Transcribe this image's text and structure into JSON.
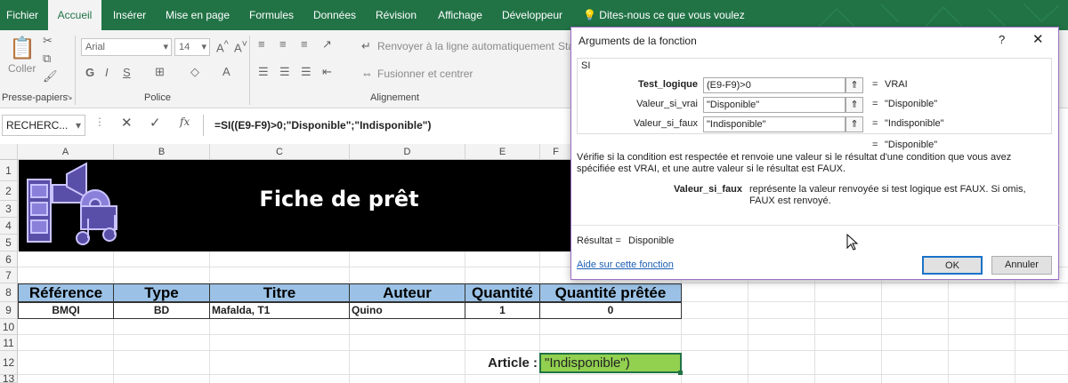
{
  "tabs": [
    "Fichier",
    "Accueil",
    "Insérer",
    "Mise en page",
    "Formules",
    "Données",
    "Révision",
    "Affichage",
    "Développeur"
  ],
  "tell_me": "Dites-nous ce que vous voulez faire",
  "ribbon": {
    "paste_label": "Coller",
    "clipboard_group": "Presse-papiers",
    "font_name": "Arial",
    "font_size": "14",
    "font_group": "Police",
    "wrap_text": "Renvoyer à la ligne automatiquement",
    "merge_center": "Fusionner et centrer",
    "alignment_group": "Alignement",
    "style_partial": "Sta"
  },
  "formula_bar": {
    "name_box": "RECHERC...",
    "formula": "=SI((E9-F9)>0;\"Disponible\";\"Indisponible\")"
  },
  "columns": [
    "A",
    "B",
    "C",
    "D",
    "E",
    "F"
  ],
  "rows": [
    "1",
    "2",
    "3",
    "4",
    "5",
    "6",
    "7",
    "8",
    "9",
    "10",
    "11",
    "12",
    "13"
  ],
  "sheet": {
    "banner_title": "Fiche de prêt",
    "headers": [
      "Référence",
      "Type",
      "Titre",
      "Auteur",
      "Quantité",
      "Quantité prêtée"
    ],
    "row9": [
      "BMQI",
      "BD",
      "Mafalda, T1",
      "Quino",
      "1",
      "0"
    ],
    "article_label": "Article :",
    "article_value": "\"Indisponible\")",
    "header_color": "#9bc2e6",
    "article_color": "#92d050"
  },
  "dialog": {
    "title": "Arguments de la fonction",
    "help_char": "?",
    "function_name": "SI",
    "args": [
      {
        "label": "Test_logique",
        "value": "(E9-F9)>0",
        "result": "VRAI"
      },
      {
        "label": "Valeur_si_vrai",
        "value": "\"Disponible\"",
        "result": "\"Disponible\""
      },
      {
        "label": "Valeur_si_faux",
        "value": "\"Indisponible\"",
        "result": "\"Indisponible\""
      }
    ],
    "overall_result": "\"Disponible\"",
    "equals": "=",
    "description": "Vérifie si la condition est respectée et renvoie une valeur si le résultat d'une condition que vous avez spécifiée est VRAI, et une autre valeur si le résultat est FAUX.",
    "arg_detail_name": "Valeur_si_faux",
    "arg_detail_text": "représente la valeur renvoyée si test logique est FAUX. Si omis, FAUX est renvoyé.",
    "result_label": "Résultat =",
    "result_value": "Disponible",
    "help_link": "Aide sur cette fonction",
    "ok_label": "OK",
    "cancel_label": "Annuler"
  }
}
